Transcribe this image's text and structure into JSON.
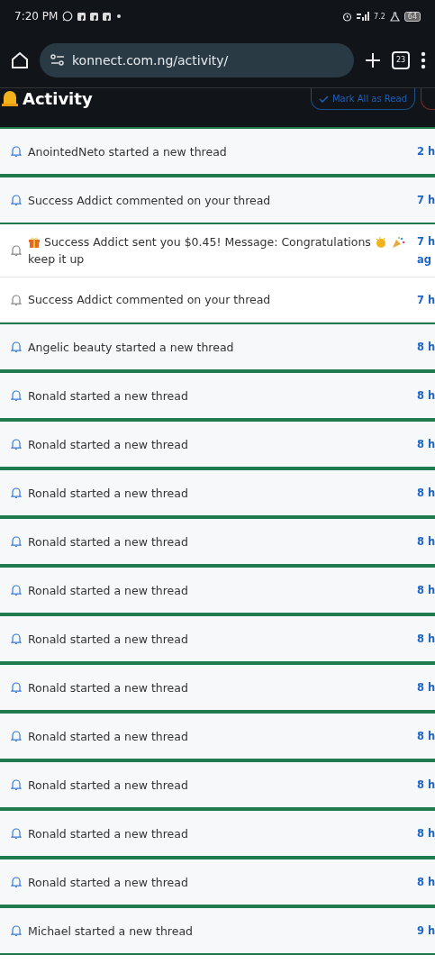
{
  "status_bar": {
    "time": "7:20 PM",
    "network_speed": "7.2",
    "battery": "64"
  },
  "browser": {
    "url": "konnect.com.ng/activity/",
    "tab_count": "23"
  },
  "header": {
    "title": "Activity",
    "mark_all_button": "Mark All as Read"
  },
  "notifications": [
    {
      "kind": "plain",
      "text": "AnointedNeto started a new thread",
      "time_lines": [
        "2 h"
      ],
      "read": false
    },
    {
      "kind": "plain",
      "text": "Success Addict commented on your thread",
      "time_lines": [
        "7 h"
      ],
      "read": false
    },
    {
      "kind": "gift",
      "text": "Success Addict sent you $0.45! Message: Congratulations",
      "continuation": "keep it up",
      "time_lines": [
        "7 h",
        "ag"
      ],
      "read": true
    },
    {
      "kind": "plain",
      "text": "Success Addict commented on your thread",
      "time_lines": [
        "7 h"
      ],
      "read": true
    },
    {
      "kind": "plain",
      "text": "Angelic beauty started a new thread",
      "time_lines": [
        "8 h"
      ],
      "read": false
    },
    {
      "kind": "plain",
      "text": "Ronald started a new thread",
      "time_lines": [
        "8 h"
      ],
      "read": false
    },
    {
      "kind": "plain",
      "text": "Ronald started a new thread",
      "time_lines": [
        "8 h"
      ],
      "read": false
    },
    {
      "kind": "plain",
      "text": "Ronald started a new thread",
      "time_lines": [
        "8 h"
      ],
      "read": false
    },
    {
      "kind": "plain",
      "text": "Ronald started a new thread",
      "time_lines": [
        "8 h"
      ],
      "read": false
    },
    {
      "kind": "plain",
      "text": "Ronald started a new thread",
      "time_lines": [
        "8 h"
      ],
      "read": false
    },
    {
      "kind": "plain",
      "text": "Ronald started a new thread",
      "time_lines": [
        "8 h"
      ],
      "read": false
    },
    {
      "kind": "plain",
      "text": "Ronald started a new thread",
      "time_lines": [
        "8 h"
      ],
      "read": false
    },
    {
      "kind": "plain",
      "text": "Ronald started a new thread",
      "time_lines": [
        "8 h"
      ],
      "read": false
    },
    {
      "kind": "plain",
      "text": "Ronald started a new thread",
      "time_lines": [
        "8 h"
      ],
      "read": false
    },
    {
      "kind": "plain",
      "text": "Ronald started a new thread",
      "time_lines": [
        "8 h"
      ],
      "read": false
    },
    {
      "kind": "plain",
      "text": "Ronald started a new thread",
      "time_lines": [
        "8 h"
      ],
      "read": false
    },
    {
      "kind": "plain",
      "text": "Michael started a new thread",
      "time_lines": [
        "9 h"
      ],
      "read": false
    }
  ]
}
